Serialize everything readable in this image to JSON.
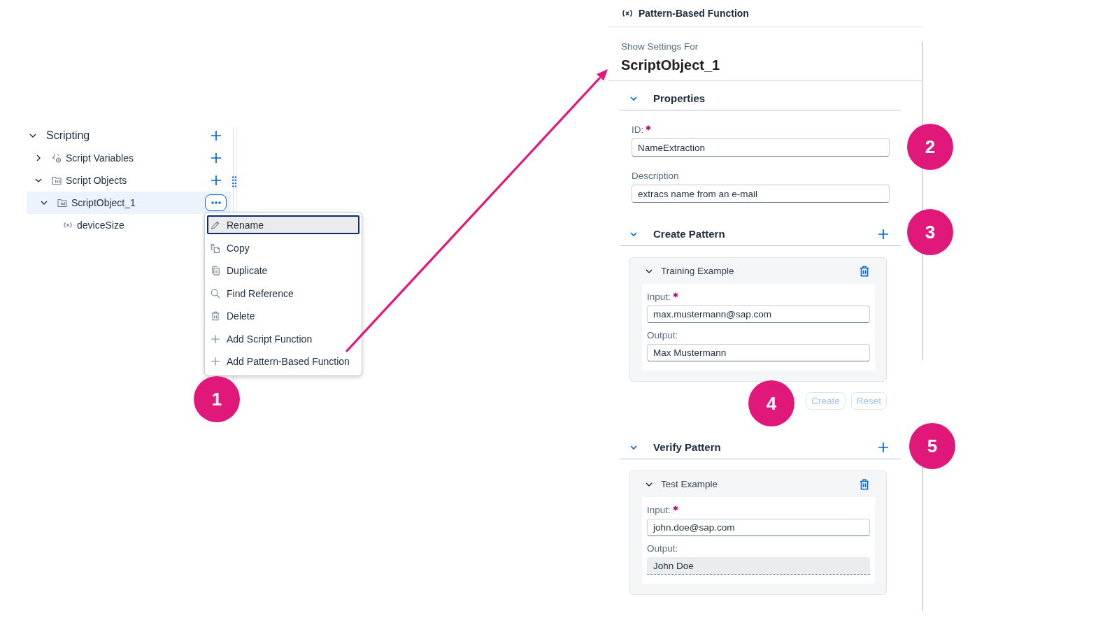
{
  "tree": {
    "items": [
      {
        "label": "Scripting",
        "kind": "group",
        "expanded": true,
        "selected": false,
        "addable": true,
        "children": [
          {
            "label": "Script Variables",
            "kind": "variables",
            "expanded": false,
            "selected": false,
            "addable": true
          },
          {
            "label": "Script Objects",
            "kind": "folder",
            "expanded": true,
            "selected": false,
            "addable": true,
            "children": [
              {
                "label": "ScriptObject_1",
                "kind": "folder",
                "expanded": true,
                "selected": true,
                "children": [
                  {
                    "label": "deviceSize",
                    "kind": "function",
                    "selected": false
                  }
                ]
              }
            ]
          }
        ]
      }
    ]
  },
  "context_menu": {
    "items": [
      {
        "label": "Rename",
        "kind": "edit",
        "selected": true
      },
      {
        "label": "Copy",
        "kind": "copy",
        "selected": false
      },
      {
        "label": "Duplicate",
        "kind": "duplicate",
        "selected": false
      },
      {
        "label": "Find Reference",
        "kind": "search",
        "selected": false
      },
      {
        "label": "Delete",
        "kind": "delete",
        "selected": false
      },
      {
        "label": "Add Script Function",
        "kind": "add",
        "selected": false
      },
      {
        "label": "Add Pattern-Based Function",
        "kind": "add",
        "selected": false
      }
    ]
  },
  "panel": {
    "title": "Pattern-Based Function",
    "settings_caption": "Show Settings For",
    "object_name": "ScriptObject_1",
    "sections": [
      {
        "kind": "form",
        "title": "Properties",
        "expanded": true,
        "fields": [
          {
            "label": "ID:",
            "required": true,
            "value": "NameExtraction"
          },
          {
            "label": "Description",
            "value": "extracs name from an e-mail"
          }
        ]
      },
      {
        "kind": "examples",
        "title": "Create Pattern",
        "expanded": true,
        "addable": true,
        "example": {
          "title": "Training Example",
          "expanded": true,
          "fields": [
            {
              "label": "Input:",
              "required": true,
              "readonly": false,
              "value": "max.mustermann@sap.com"
            },
            {
              "label": "Output:",
              "readonly": false,
              "value": "Max Mustermann"
            }
          ]
        },
        "buttons": [
          {
            "label": "Create",
            "disabled": true
          },
          {
            "label": "Reset",
            "disabled": true
          }
        ]
      },
      {
        "kind": "examples",
        "title": "Verify Pattern",
        "expanded": true,
        "addable": true,
        "example": {
          "title": "Test Example",
          "expanded": true,
          "fields": [
            {
              "label": "Input:",
              "required": true,
              "readonly": false,
              "value": "john.doe@sap.com"
            },
            {
              "label": "Output:",
              "readonly": true,
              "value": "John Doe"
            }
          ]
        }
      }
    ]
  },
  "callouts": [
    {
      "number": "1"
    },
    {
      "number": "2"
    },
    {
      "number": "3"
    },
    {
      "number": "4"
    },
    {
      "number": "5"
    }
  ]
}
